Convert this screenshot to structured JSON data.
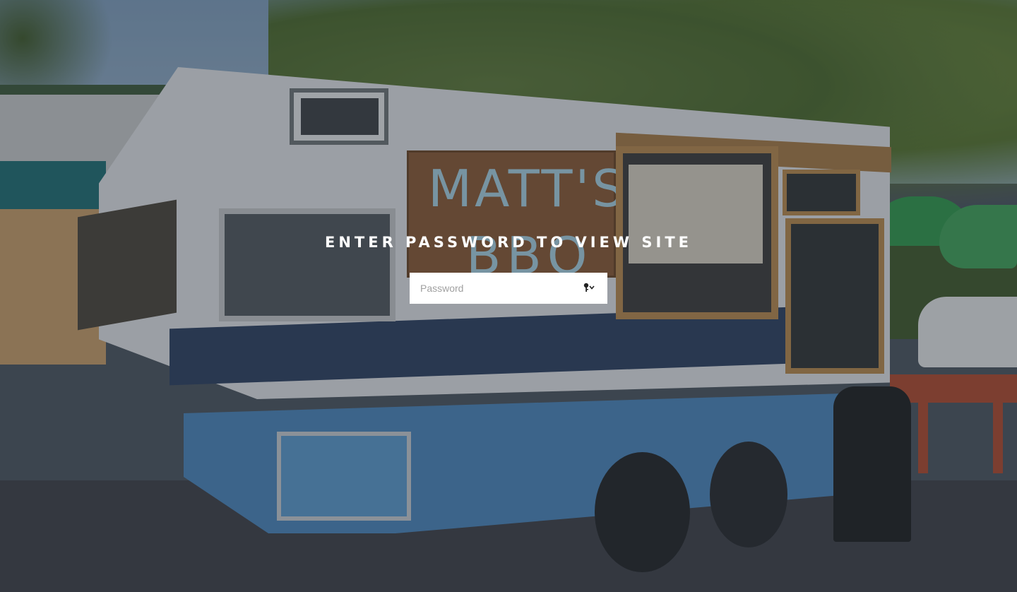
{
  "password_page": {
    "heading": "ENTER PASSWORD TO VIEW SITE",
    "input": {
      "placeholder": "Password",
      "value": ""
    },
    "submit_icon": "key-dropdown-icon"
  },
  "background": {
    "sign_line_1": "MATT'S",
    "sign_line_2": "BBQ",
    "colors": {
      "overlay": "#282c34",
      "heading_text": "#ffffff",
      "input_bg": "#ffffff",
      "placeholder": "#a0a0a0"
    }
  }
}
